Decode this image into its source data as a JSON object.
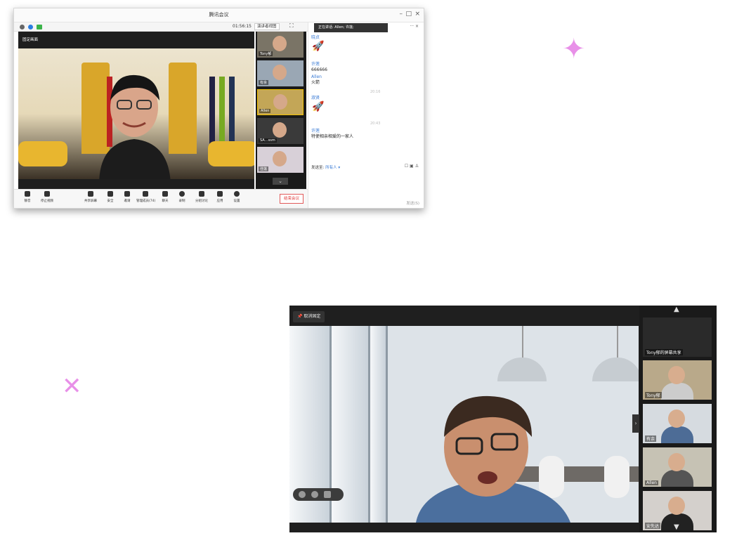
{
  "top_window": {
    "title": "腾讯会议",
    "timer": "01:56:15",
    "view_button": "演讲者视图",
    "pin_label": "固定画面",
    "participants": [
      {
        "name": "Tony郁"
      },
      {
        "name": "有余"
      },
      {
        "name": "Allen"
      },
      {
        "name": "SA…ssm"
      },
      {
        "name": "佳莲"
      }
    ],
    "chat": {
      "tip": "正在讲话: Allen; 许莲;",
      "messages": [
        {
          "name": "晓贞",
          "text": ""
        },
        {
          "name": "许莲",
          "text": "666666"
        },
        {
          "name": "Allen",
          "text": "火箭"
        },
        {
          "name": "淑贤",
          "text": ""
        },
        {
          "name": "许莲",
          "text": "特使相亲相爱的一家人"
        }
      ],
      "timestamps": [
        "20:16",
        "20:43"
      ],
      "send_to_label": "发送至:",
      "send_to_value": "所有人 ▾",
      "send_button": "发送(S)"
    },
    "toolbar": [
      {
        "label": "静音"
      },
      {
        "label": "停止视频"
      },
      {
        "label": "共享屏幕"
      },
      {
        "label": "安全"
      },
      {
        "label": "邀请"
      },
      {
        "label": "管理成员(74)"
      },
      {
        "label": "聊天"
      },
      {
        "label": "录制"
      },
      {
        "label": "分组讨论"
      },
      {
        "label": "应用"
      },
      {
        "label": "设置"
      }
    ],
    "end_button": "结束会议"
  },
  "bottom_window": {
    "unpin_label": "取消固定",
    "participants": [
      {
        "name": "Tony郁的屏幕共享"
      },
      {
        "name": "Tony郁"
      },
      {
        "name": "有余"
      },
      {
        "name": "Allen"
      },
      {
        "name": "安先达"
      }
    ]
  },
  "colors": {
    "accent_blue": "#3a7bd5",
    "end_red": "#e03c3c",
    "sparkle": "#e890e8",
    "host_orange": "#f07c1e"
  }
}
